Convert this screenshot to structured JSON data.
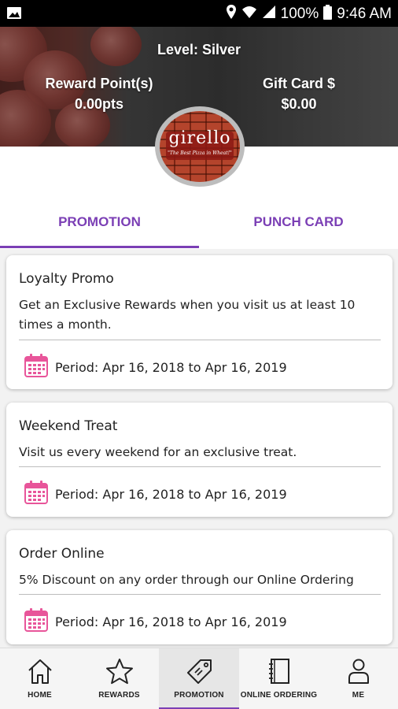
{
  "status_bar": {
    "battery": "100%",
    "time": "9:46 AM"
  },
  "header": {
    "level": "Level: Silver",
    "reward_points_label": "Reward Point(s)",
    "reward_points_value": "0.00pts",
    "gift_card_label": "Gift Card $",
    "gift_card_value": "$0.00"
  },
  "logo": {
    "name": "girello",
    "tagline": "\"The Best Pizza in Wheat!\""
  },
  "tabs": [
    {
      "label": "PROMOTION",
      "active": true
    },
    {
      "label": "PUNCH CARD",
      "active": false
    }
  ],
  "promotions": [
    {
      "title": "Loyalty Promo",
      "description": "Get an Exclusive Rewards when you visit us at least 10 times a month.",
      "period": "Period: Apr 16, 2018 to Apr 16, 2019"
    },
    {
      "title": "Weekend Treat",
      "description": "Visit us every weekend for an exclusive treat.",
      "period": "Period: Apr 16, 2018 to Apr 16, 2019"
    },
    {
      "title": "Order Online",
      "description": "5% Discount on any order through our Online Ordering",
      "period": "Period: Apr 16, 2018 to Apr 16, 2019"
    }
  ],
  "bottom_nav": [
    {
      "label": "HOME",
      "icon": "home-icon"
    },
    {
      "label": "REWARDS",
      "icon": "star-icon"
    },
    {
      "label": "PROMOTION",
      "icon": "tag-icon",
      "active": true
    },
    {
      "label": "ONLINE ORDERING",
      "icon": "notebook-icon"
    },
    {
      "label": "ME",
      "icon": "person-icon"
    }
  ],
  "colors": {
    "accent": "#7b3fb5",
    "calendar": "#e8559a"
  }
}
